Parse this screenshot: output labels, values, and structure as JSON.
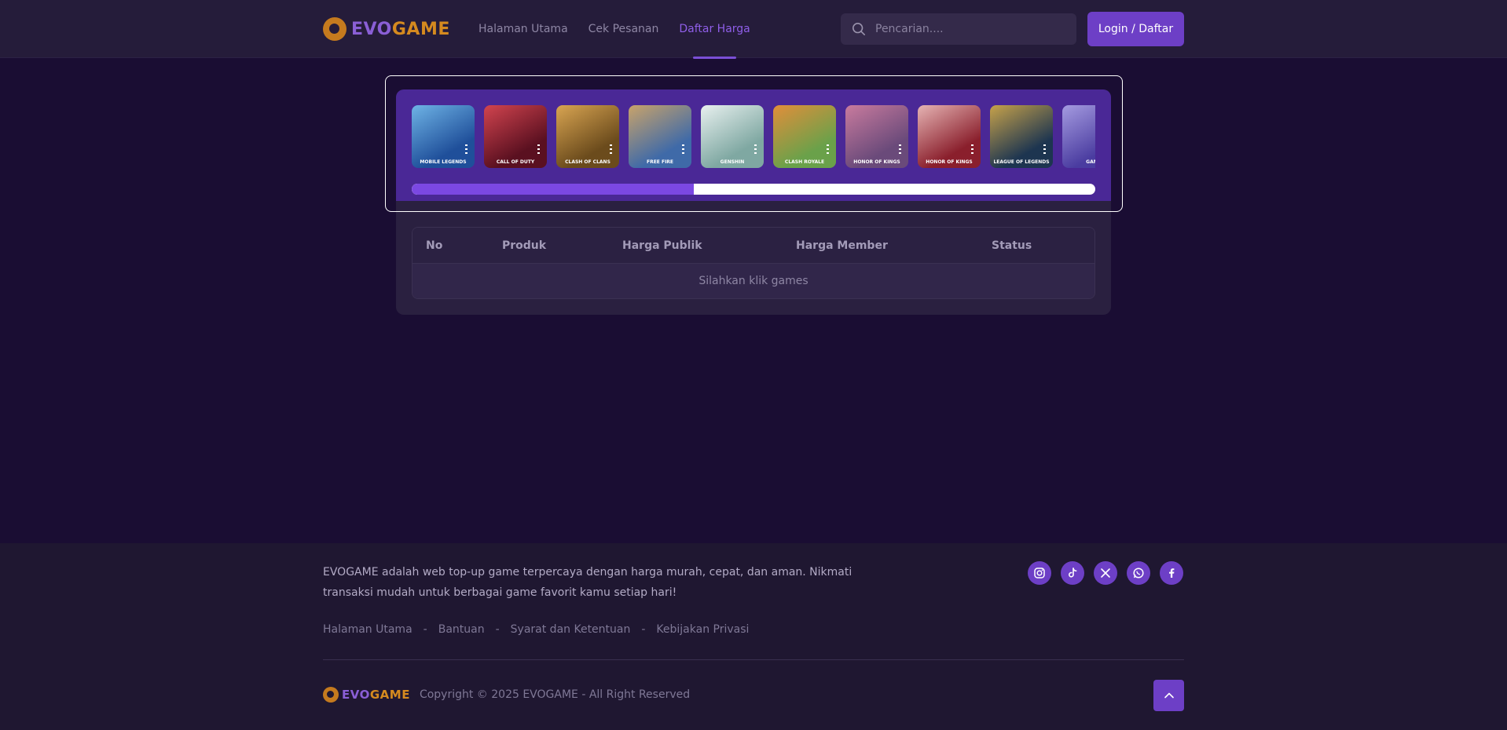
{
  "header": {
    "logo_text_a": "EVO",
    "logo_text_b": "GAME",
    "nav": [
      {
        "label": "Halaman Utama",
        "active": false
      },
      {
        "label": "Cek Pesanan",
        "active": false
      },
      {
        "label": "Daftar Harga",
        "active": true
      }
    ],
    "search_placeholder": "Pencarian....",
    "login_label": "Login / Daftar"
  },
  "games": [
    {
      "caption": "MOBILE LEGENDS",
      "c1": "#1f4f9a",
      "c2": "#6fb4e6"
    },
    {
      "caption": "CALL OF DUTY",
      "c1": "#5a1020",
      "c2": "#d2444f"
    },
    {
      "caption": "CLASH OF CLANS",
      "c1": "#6b4b1c",
      "c2": "#d9a552"
    },
    {
      "caption": "FREE FIRE",
      "c1": "#3f6aa8",
      "c2": "#c9a36a"
    },
    {
      "caption": "GENSHIN",
      "c1": "#7fa8a2",
      "c2": "#e8f0ef"
    },
    {
      "caption": "CLASH ROYALE",
      "c1": "#6aa14a",
      "c2": "#e28e3a"
    },
    {
      "caption": "HONOR OF KINGS",
      "c1": "#6a4a7a",
      "c2": "#c97b9e"
    },
    {
      "caption": "HONOR OF KINGS",
      "c1": "#8a1f2c",
      "c2": "#e6b4b4"
    },
    {
      "caption": "LEAGUE OF LEGENDS",
      "c1": "#1d3550",
      "c2": "#c7a24a"
    },
    {
      "caption": "GAME",
      "c1": "#4a3ca0",
      "c2": "#a59be0"
    }
  ],
  "slider_progress": 0.413,
  "table": {
    "headers": [
      "No",
      "Produk",
      "Harga Publik",
      "Harga Member",
      "Status"
    ],
    "empty_text": "Silahkan klik games"
  },
  "footer": {
    "description": "EVOGAME adalah web top-up game terpercaya dengan harga murah, cepat, dan aman. Nikmati transaksi mudah untuk berbagai game favorit kamu setiap hari!",
    "links": [
      "Halaman Utama",
      "Bantuan",
      "Syarat dan Ketentuan",
      "Kebijakan Privasi"
    ],
    "separator": "-",
    "socials": [
      "instagram-icon",
      "tiktok-icon",
      "x-icon",
      "whatsapp-icon",
      "facebook-icon"
    ],
    "copyright": "Copyright © 2025 EVOGAME - All Right Reserved"
  },
  "colors": {
    "accent": "#6d3fc6",
    "active_nav": "#8f5ee8",
    "logo_orange": "#d58a1f",
    "logo_purple": "#8a5fd6"
  }
}
